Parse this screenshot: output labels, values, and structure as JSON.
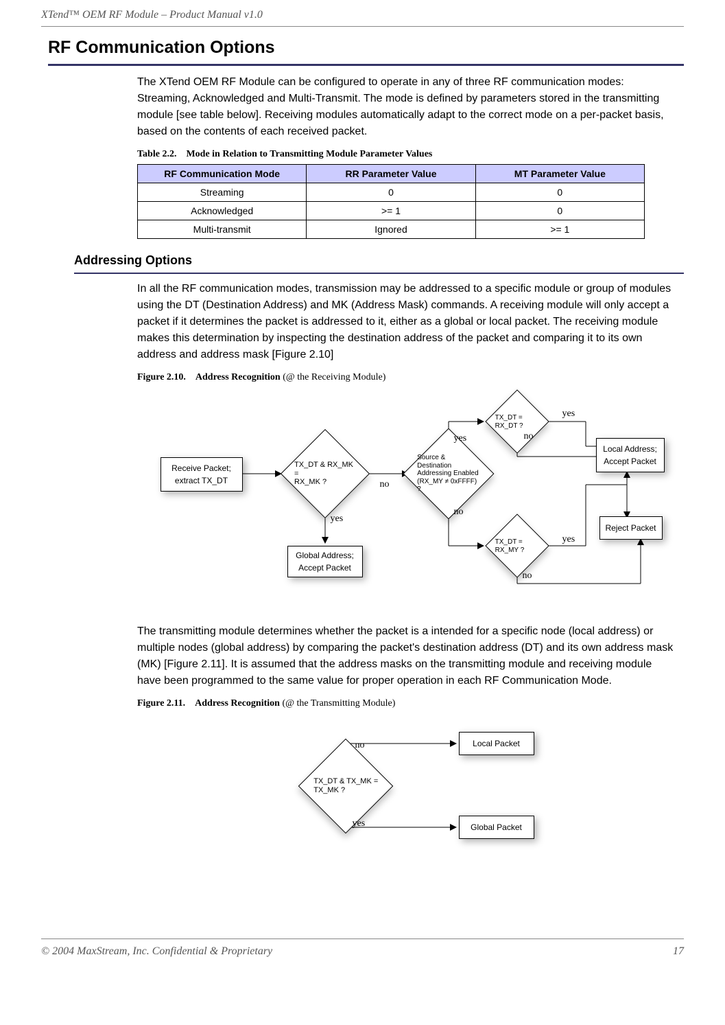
{
  "header": "XTend™ OEM RF Module – Product Manual v1.0",
  "footer": {
    "text": "© 2004 MaxStream, Inc. Confidential & Proprietary",
    "page": "17"
  },
  "heading1": "RF Communication Options",
  "intro_para": "The XTend OEM RF Module can be configured to operate in any of three RF communication modes: Streaming, Acknowledged and Multi-Transmit. The mode is defined by parameters stored in the transmitting module [see table below]. Receiving modules automatically adapt to the correct mode on a per-packet basis, based on the contents of each received packet.",
  "table_caption": {
    "prefix": "Table 2.2.",
    "title": "Mode in Relation to Transmitting Module Parameter Values"
  },
  "table": {
    "columns": [
      "RF Communication Mode",
      "RR Parameter Value",
      "MT Parameter Value"
    ],
    "rows": [
      [
        "Streaming",
        "0",
        "0"
      ],
      [
        "Acknowledged",
        ">= 1",
        "0"
      ],
      [
        "Multi-transmit",
        "Ignored",
        ">= 1"
      ]
    ]
  },
  "heading2": "Addressing Options",
  "addr_para1": "In all the RF communication modes, transmission may be addressed to a specific module or group of modules using the DT (Destination Address) and MK (Address Mask) commands. A receiving module will only accept a packet if it determines the packet is addressed to it, either as a global or local packet. The receiving module makes this determination by inspecting the destination address of the packet and comparing it to its own address and address mask [Figure 2.10]",
  "figure210_caption": {
    "prefix": "Figure 2.10.",
    "bold": "Address Recognition",
    "rest": " (@ the Receiving Module)"
  },
  "addr_para2": "The transmitting module determines whether the packet is a intended for a specific node (local address) or multiple nodes (global address) by comparing the packet's destination address (DT) and its own address mask (MK) [Figure 2.11]. It is assumed that the address masks on the transmitting module and receiving module have been programmed to the same value for proper operation in each RF Communication Mode.",
  "figure211_caption": {
    "prefix": "Figure 2.11.",
    "bold": "Address Recognition",
    "rest": " (@ the Transmitting Module)"
  },
  "figure210": {
    "rx_extract": "Receive Packet;\nextract TX_DT",
    "d_mask_eq": "TX_DT & RX_MK =\nRX_MK ?",
    "d_addr_en": "Source & Destination\nAddressing Enabled\n(RX_MY ≠ 0xFFFF) ?",
    "d_dt_eq_dt": "TX_DT = RX_DT ?",
    "d_dt_eq_my": "TX_DT = RX_MY ?",
    "box_global": "Global Address;\nAccept Packet",
    "box_local": "Local Address;\nAccept Packet",
    "box_reject": "Reject Packet",
    "lbl_no": "no",
    "lbl_yes": "yes"
  },
  "figure211": {
    "d_q": "TX_DT & TX_MK =\nTX_MK ?",
    "box_local": "Local Packet",
    "box_global": "Global Packet",
    "lbl_no": "no",
    "lbl_yes": "yes"
  }
}
